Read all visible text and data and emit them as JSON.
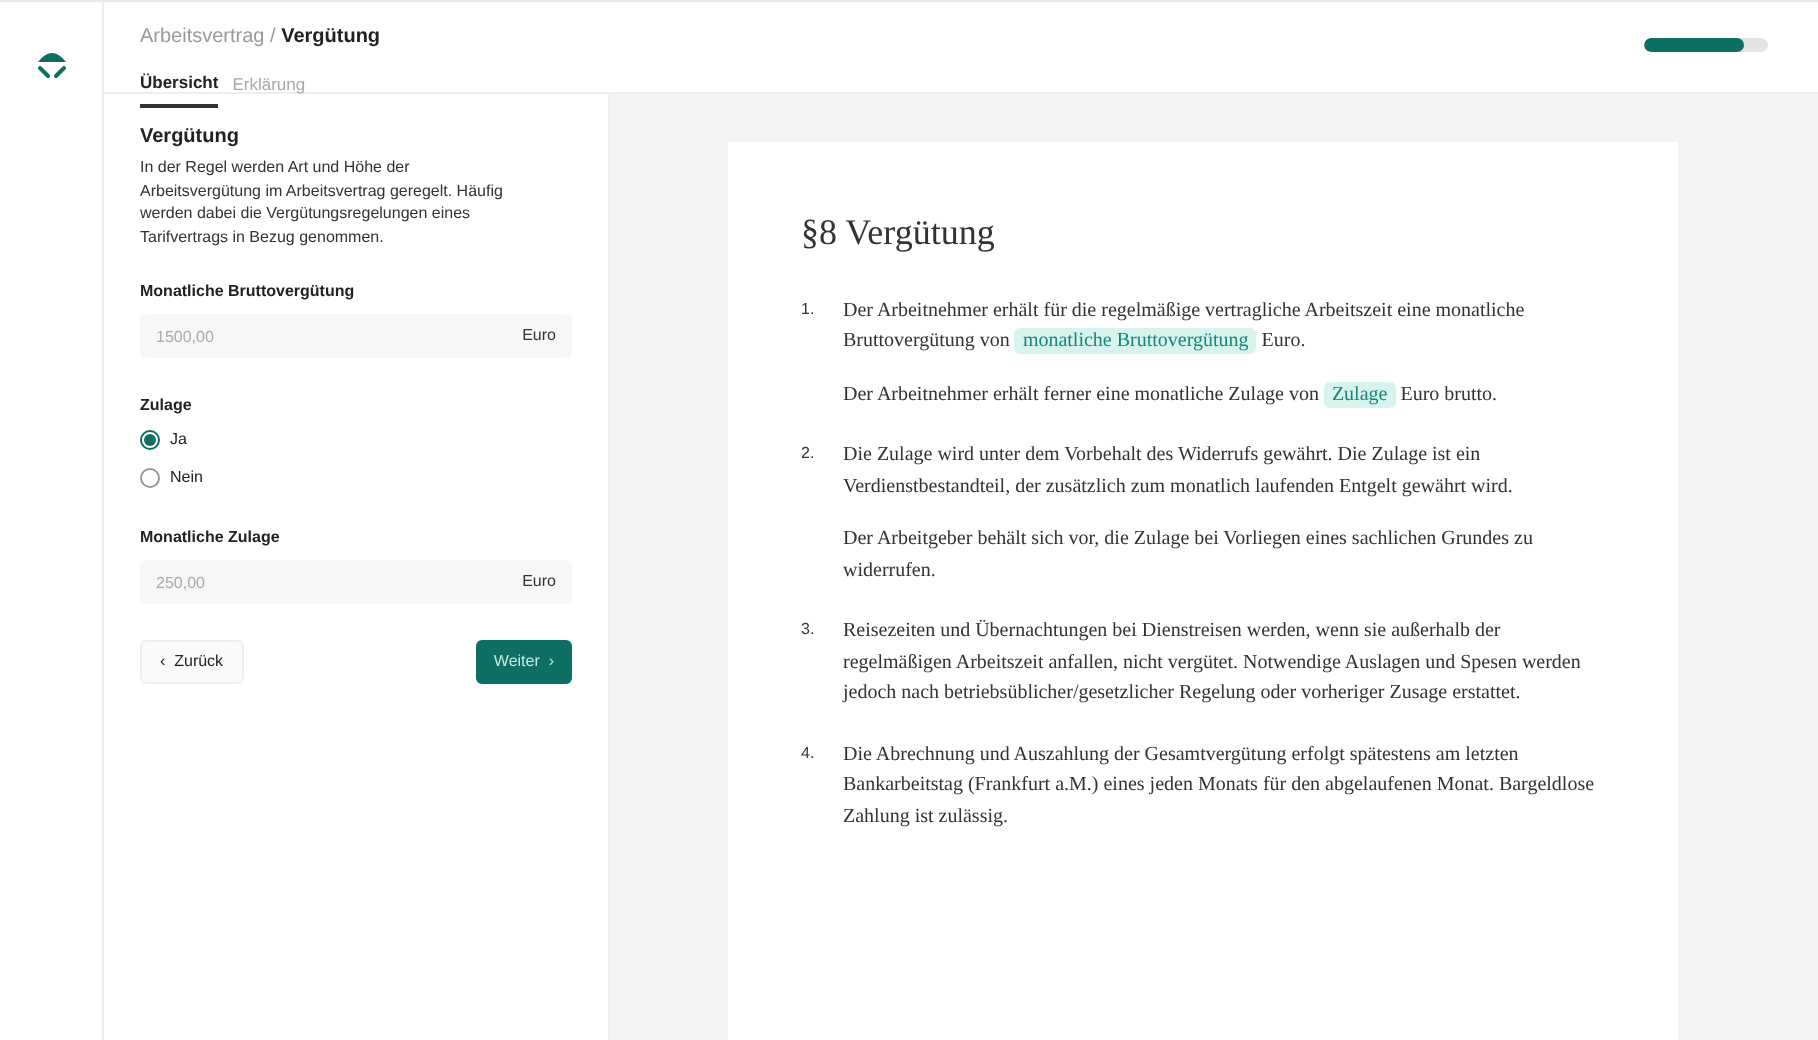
{
  "breadcrumb": {
    "parent": "Arbeitsvertrag",
    "separator": "/",
    "current": "Vergütung"
  },
  "tabs": [
    {
      "label": "Übersicht",
      "selected": true
    },
    {
      "label": "Erklärung",
      "selected": false
    }
  ],
  "progress": {
    "level": 0.8
  },
  "panel": {
    "title": "Vergütung",
    "description": "In der Regel werden Art und Höhe der Arbeitsvergütung im Arbeitsvertrag geregelt. Häufig werden dabei die Vergütungsregelungen eines Tarifvertrags in Bezug genommen.",
    "fields": [
      {
        "kind": "input",
        "label": "Monatliche Bruttovergütung",
        "placeholder": "1500,00",
        "unit": "Euro"
      },
      {
        "kind": "radio",
        "label": "Zulage",
        "options": [
          {
            "label": "Ja",
            "selected": true
          },
          {
            "label": "Nein",
            "selected": false
          }
        ]
      },
      {
        "kind": "input",
        "label": "Monatliche Zulage",
        "placeholder": "250,00",
        "unit": "Euro"
      }
    ],
    "back_button": {
      "icon": "‹",
      "label": "Zurück"
    },
    "next_button": {
      "label": "Weiter",
      "icon": "›"
    }
  },
  "document": {
    "title": "§8 Vergütung",
    "items": [
      {
        "number": "1.",
        "paragraphs": [
          [
            {
              "kind": "text",
              "text": "Der Arbeitnehmer erhält für die regelmäßige vertragliche Arbeitszeit eine monatliche Bruttovergütung von "
            },
            {
              "kind": "field",
              "text": "monatliche Bruttovergütung"
            },
            {
              "kind": "text",
              "text": " Euro."
            }
          ],
          [
            {
              "kind": "text",
              "text": "Der Arbeitnehmer erhält ferner eine monatliche Zulage von "
            },
            {
              "kind": "field",
              "text": "Zulage"
            },
            {
              "kind": "text",
              "text": " Euro brutto."
            }
          ]
        ]
      },
      {
        "number": "2.",
        "paragraphs": [
          [
            {
              "kind": "text",
              "text": "Die Zulage wird unter dem Vorbehalt des Widerrufs gewährt. Die Zulage ist ein Verdienstbestandteil, der zusätzlich zum monatlich laufenden Entgelt gewährt wird."
            }
          ],
          [
            {
              "kind": "text",
              "text": "Der Arbeitgeber behält sich vor, die Zulage bei Vorliegen eines sachlichen Grundes zu widerrufen."
            }
          ]
        ]
      },
      {
        "number": "3.",
        "paragraphs": [
          [
            {
              "kind": "text",
              "text": "Reisezeiten und Übernachtungen bei Dienstreisen werden, wenn sie außerhalb der regelmäßigen Arbeitszeit anfallen, nicht vergütet. Notwendige Auslagen und Spesen werden jedoch nach betriebsüblicher/gesetzlicher Regelung oder vorheriger Zusage erstattet."
            }
          ]
        ]
      },
      {
        "number": "4.",
        "paragraphs": [
          [
            {
              "kind": "text",
              "text": "Die Abrechnung und Auszahlung der Gesamtvergütung erfolgt spätestens am letzten Bankarbeitstag (Frankfurt a.M.) eines jeden Monats für den abgelaufenen Monat. Bargeldlose Zahlung ist zulässig."
            }
          ]
        ]
      }
    ]
  }
}
